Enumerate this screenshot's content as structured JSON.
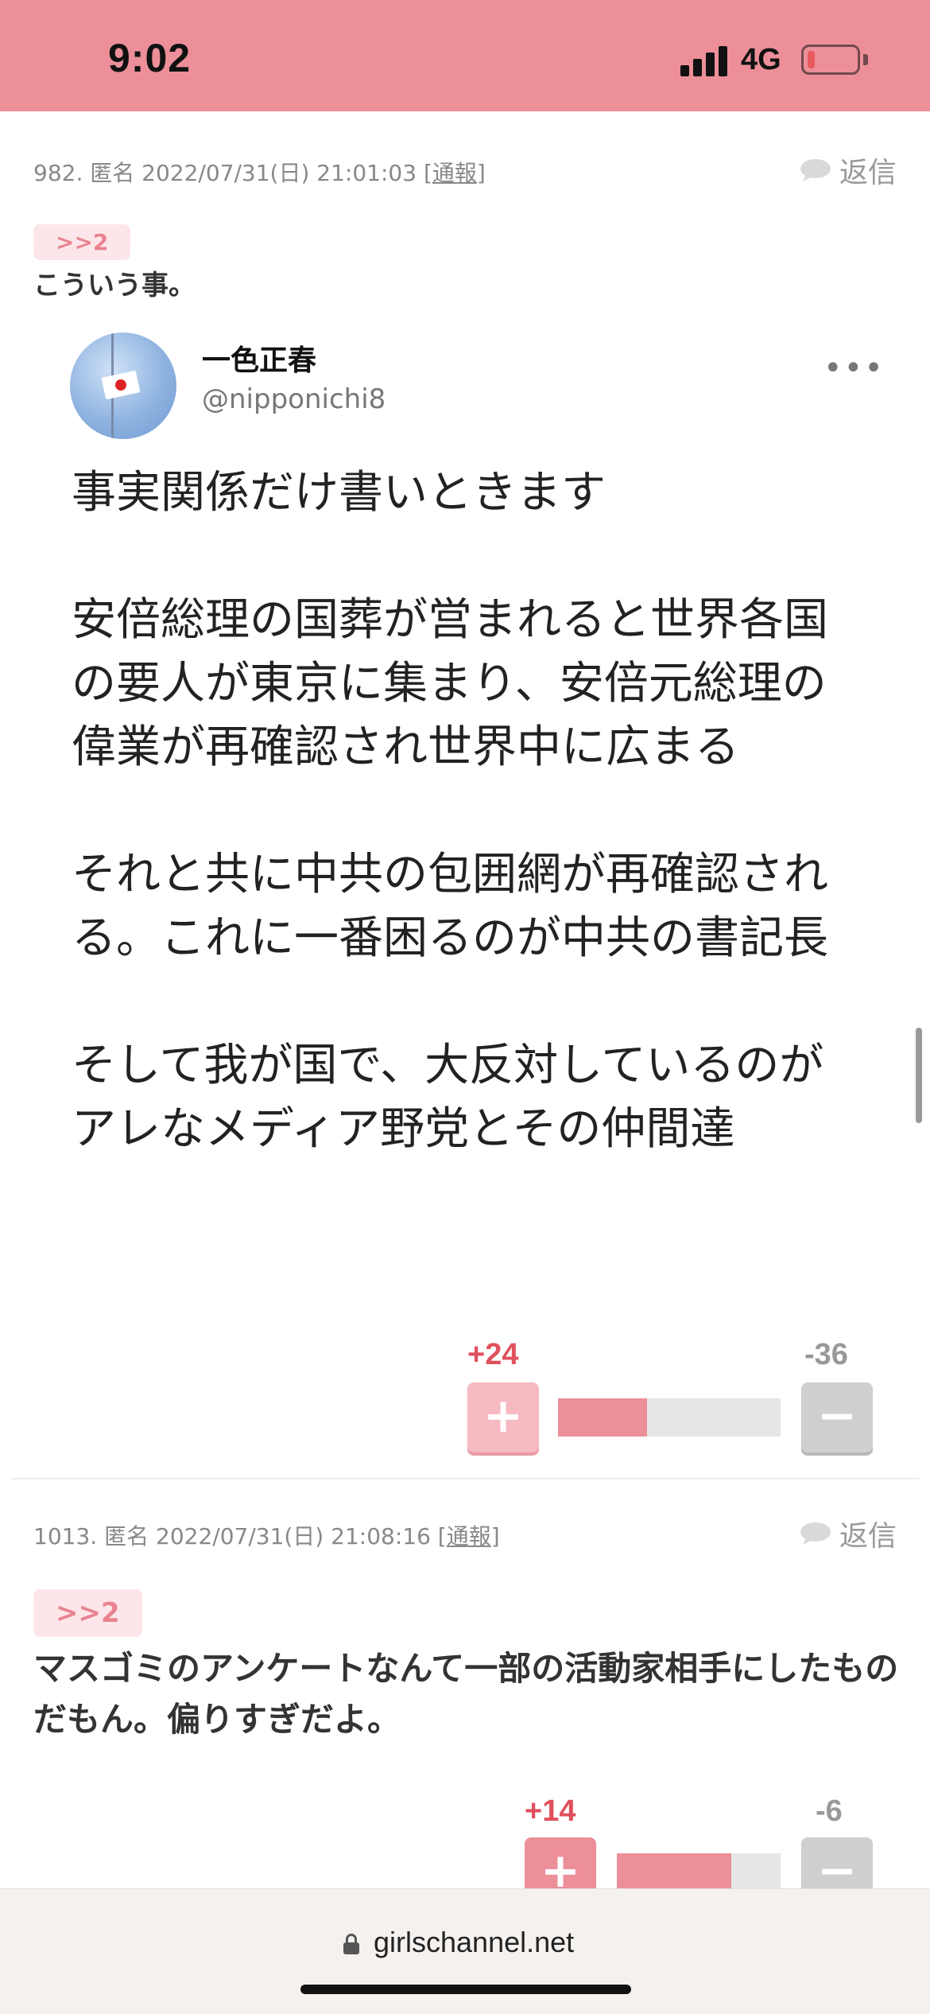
{
  "status_bar": {
    "time": "9:02",
    "network": "4G",
    "battery_level": 0.15,
    "background_color": "#ec8f99"
  },
  "comments": [
    {
      "number": "982.",
      "author": "匿名",
      "datetime": "2022/07/31(日) 21:01:03",
      "report_label": "通報",
      "reply_label": "返信",
      "anchor": ">>2",
      "body": "こういう事。",
      "tweet": {
        "name": "一色正春",
        "handle": "@nipponichi8",
        "more_icon": "more-dots-icon",
        "paragraphs": [
          "事実関係だけ書いときます",
          "安倍総理の国葬が営まれると世界各国の要人が東京に集まり、安倍元総理の偉業が再確認され世界中に広まる",
          "それと共に中共の包囲網が再確認される。これに一番困るのが中共の書記長",
          "そして我が国で、大反対しているのがアレなメディア野党とその仲間達"
        ]
      },
      "votes": {
        "plus": "+24",
        "minus": "-36",
        "plus_ratio": 0.4
      }
    },
    {
      "number": "1013.",
      "author": "匿名",
      "datetime": "2022/07/31(日) 21:08:16",
      "report_label": "通報",
      "reply_label": "返信",
      "anchor": ">>2",
      "body": "マスゴミのアンケートなんて一部の活動家相手にしたものだもん。偏りすぎだよ。",
      "votes": {
        "plus": "+14",
        "minus": "-6",
        "plus_ratio": 0.7
      }
    }
  ],
  "vote_symbols": {
    "plus": "+",
    "minus": "−"
  },
  "url_bar": {
    "url": "girlschannel.net",
    "icon": "lock-icon"
  },
  "colors": {
    "accent": "#ec8f99",
    "plus_text": "#e0505c",
    "anchor_bg": "#fde6ea",
    "anchor_text": "#e8838f"
  }
}
